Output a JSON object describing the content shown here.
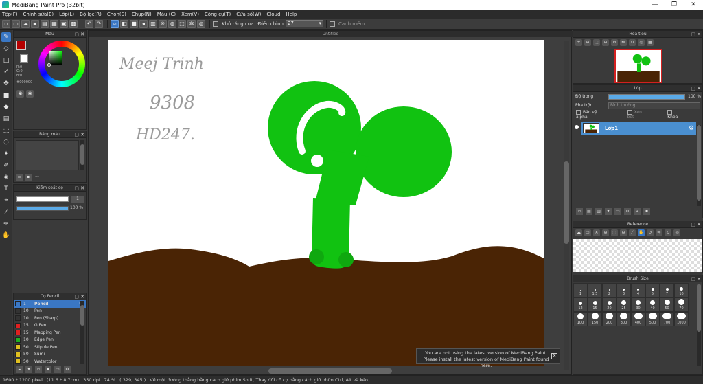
{
  "window": {
    "title": "MediBang Paint Pro (32bit)",
    "min": "—",
    "max": "❐",
    "close": "✕"
  },
  "menu": [
    "Tệp(F)",
    "Chỉnh sửa(E)",
    "Lớp(L)",
    "Bộ lọc(R)",
    "Chọn(S)",
    "Chụp(N)",
    "Màu (C)",
    "Xem(V)",
    "Công cụ(T)",
    "Cửa số(W)",
    "Cloud",
    "Help"
  ],
  "toolbar": {
    "antialias_label": "Khử răng cưa",
    "correction_label": "Điều chỉnh",
    "correction_value": "27",
    "softedge_label": "Cạnh mềm"
  },
  "panels": {
    "color": {
      "title": "Màu",
      "r": "R:0",
      "g": "G:0",
      "b": "B:0",
      "hex": "#000000"
    },
    "palette": {
      "title": "Bảng màu",
      "more": "···"
    },
    "brush_control": {
      "title": "Kiểm soát cọ",
      "size": "1",
      "opacity": "100 %",
      "opacity_fraction": 1.0
    },
    "brush_list": {
      "title": "Cọ Pencil",
      "items": [
        {
          "size": "1",
          "name": "Pencil",
          "color": "#3a77c4"
        },
        {
          "size": "10",
          "name": "Pen",
          "color": "#333333"
        },
        {
          "size": "10",
          "name": "Pen (Sharp)",
          "color": "#333333"
        },
        {
          "size": "15",
          "name": "G Pen",
          "color": "#e02020"
        },
        {
          "size": "15",
          "name": "Mapping Pen",
          "color": "#e02020"
        },
        {
          "size": "10",
          "name": "Edge Pen",
          "color": "#20b020"
        },
        {
          "size": "50",
          "name": "Stipple Pen",
          "color": "#e0c020"
        },
        {
          "size": "50",
          "name": "Sumi",
          "color": "#e0c020"
        },
        {
          "size": "50",
          "name": "Watercolor",
          "color": "#e0c020"
        }
      ]
    },
    "navigator": {
      "title": "Hoa tiêu"
    },
    "layer": {
      "title": "Lớp",
      "opacity_label": "Độ trong",
      "opacity_value": "100 %",
      "blend_label": "Pha trộn",
      "blend_value": "Bình thường",
      "protect_alpha": "Bảo vệ alpha",
      "clipping": "Xén bớt",
      "lock": "Khóa",
      "layer_name": "Lớp1"
    },
    "reference": {
      "title": "Reference"
    },
    "brush_size": {
      "title": "Brush Size",
      "sizes": [
        "1",
        "1.5",
        "2",
        "3",
        "4",
        "5",
        "7",
        "10",
        "12",
        "15",
        "20",
        "25",
        "30",
        "40",
        "50",
        "70",
        "100",
        "150",
        "200",
        "300",
        "400",
        "500",
        "700",
        "1000"
      ]
    }
  },
  "canvas": {
    "tab_title": "Untitled",
    "handwriting": [
      "Meej Trinh",
      "9308",
      "HD247."
    ]
  },
  "notice": {
    "line1": "You are not using the latest version of MediBang Paint.",
    "line2": "Please install the latest version of MediBang Paint found here.",
    "close": "✕"
  },
  "status": {
    "size": "1600 * 1200 pixel",
    "physical": "(11.6 * 8.7cm)",
    "dpi": "350 dpi",
    "zoom": "74 %",
    "coords": "( 329, 345 )",
    "hint": "Vẽ một đường thẳng bằng cách giữ phím Shift, Thay đổi cỡ cọ bằng cách giữ phím Ctrl, Alt và kéo"
  },
  "colors": {
    "accent": "#3a77c4",
    "plant": "#11c211",
    "soil": "#4a2405"
  }
}
